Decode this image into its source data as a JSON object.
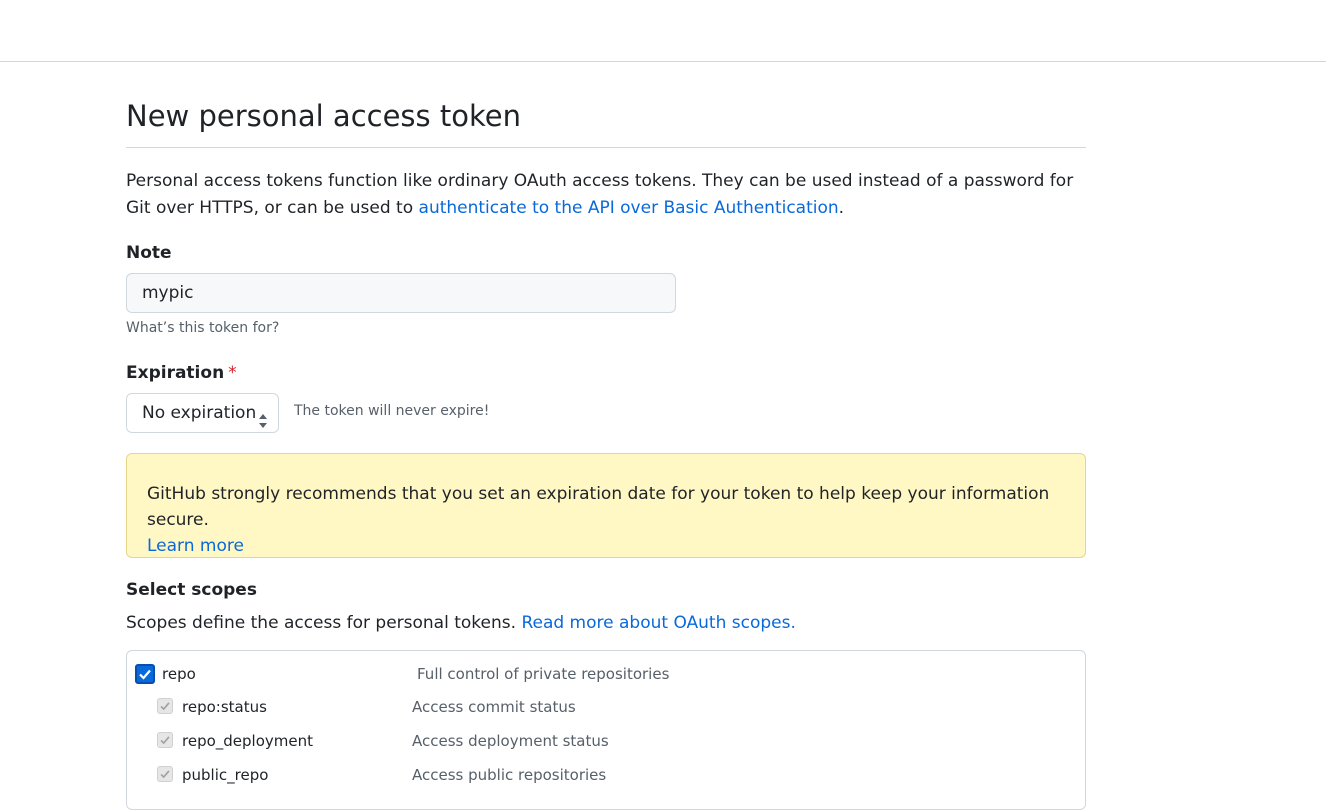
{
  "page": {
    "title": "New personal access token",
    "intro_text": "Personal access tokens function like ordinary OAuth access tokens. They can be used instead of a password for Git over HTTPS, or can be used to ",
    "intro_link": "authenticate to the API over Basic Authentication",
    "intro_end": "."
  },
  "note": {
    "label": "Note",
    "value": "mypic",
    "hint": "What’s this token for?"
  },
  "expiration": {
    "label": "Expiration",
    "required_mark": "*",
    "selected": "No expiration",
    "message": "The token will never expire!"
  },
  "flash": {
    "text": "GitHub strongly recommends that you set an expiration date for your token to help keep your information secure.",
    "link": "Learn more"
  },
  "scopes": {
    "title": "Select scopes",
    "desc": "Scopes define the access for personal tokens. ",
    "desc_link": "Read more about OAuth scopes.",
    "items": [
      {
        "name": "repo",
        "desc": "Full control of private repositories",
        "checked": true
      },
      {
        "name": "repo:status",
        "desc": "Access commit status",
        "checked": true
      },
      {
        "name": "repo_deployment",
        "desc": "Access deployment status",
        "checked": true
      },
      {
        "name": "public_repo",
        "desc": "Access public repositories",
        "checked": true
      }
    ]
  },
  "colors": {
    "link": "#0969da",
    "required": "#cf222e",
    "flash_bg": "#fff8c5",
    "checkbox_checked": "#0969da"
  }
}
